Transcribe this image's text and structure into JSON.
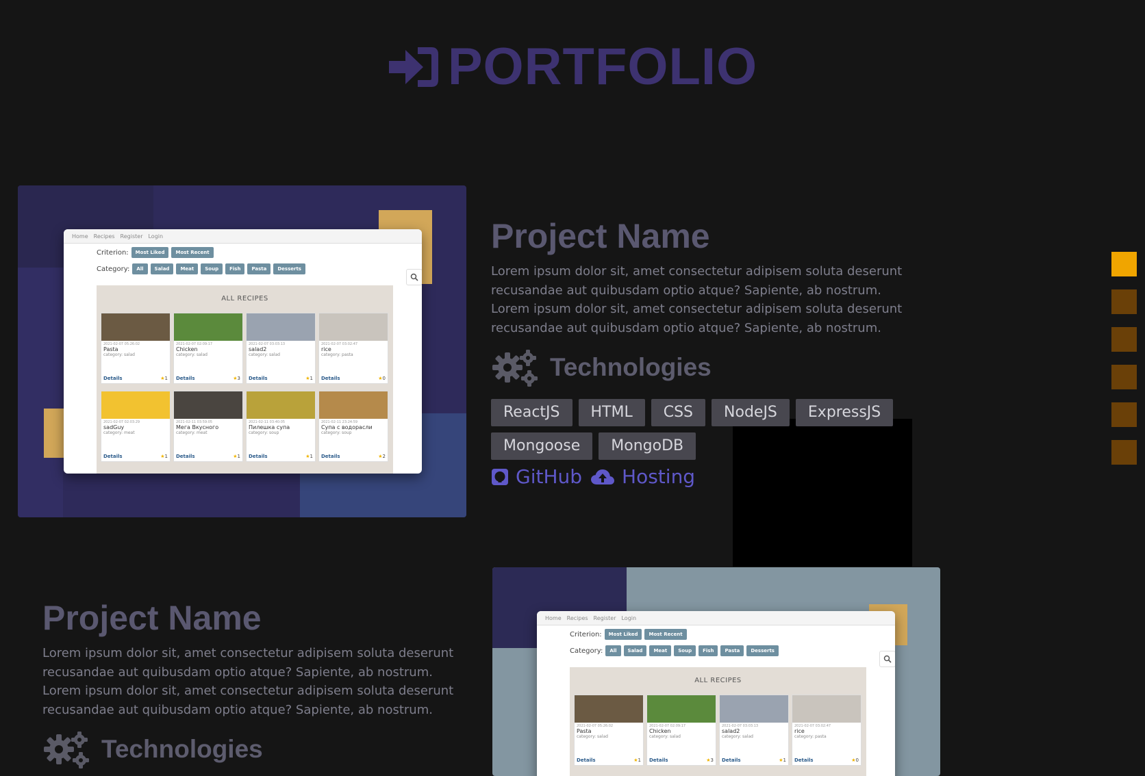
{
  "header": {
    "title": "PORTFOLIO",
    "icon": "sign-in-icon"
  },
  "projects": [
    {
      "name": "Project Name",
      "description": "Lorem ipsum dolor sit, amet consectetur adipisem soluta deserunt recusandae aut quibusdam optio atque? Sapiente, ab nostrum. Lorem ipsum dolor sit, amet consectetur adipisem soluta deserunt recusandae aut quibusdam optio atque? Sapiente, ab nostrum.",
      "tech_label": "Technologies",
      "technologies": [
        "ReactJS",
        "HTML",
        "CSS",
        "NodeJS",
        "ExpressJS",
        "Mongoose",
        "MongoDB"
      ],
      "links": {
        "github": "GitHub",
        "hosting": "Hosting"
      }
    },
    {
      "name": "Project Name",
      "description": "Lorem ipsum dolor sit, amet consectetur adipisem soluta deserunt recusandae aut quibusdam optio atque? Sapiente, ab nostrum. Lorem ipsum dolor sit, amet consectetur adipisem soluta deserunt recusandae aut quibusdam optio atque? Sapiente, ab nostrum.",
      "tech_label": "Technologies"
    }
  ],
  "preview": {
    "nav": [
      "Home",
      "Recipes",
      "Register",
      "Login"
    ],
    "criterion_label": "Criterion:",
    "criterion_options": [
      "Most Liked",
      "Most Recent"
    ],
    "category_label": "Category:",
    "categories": [
      "All",
      "Salad",
      "Meat",
      "Soup",
      "Fish",
      "Pasta",
      "Desserts"
    ],
    "section_title": "ALL RECIPES",
    "details_label": "Details",
    "recipes": [
      {
        "date": "2021-02-07 05:26:02",
        "name": "Pasta",
        "category": "category: salad",
        "likes": "1",
        "color": "#6b5a43"
      },
      {
        "date": "2021-02-07 02:09:17",
        "name": "Chicken",
        "category": "category: salad",
        "likes": "3",
        "color": "#5b8a3c"
      },
      {
        "date": "2021-02-07 03:03:13",
        "name": "salad2",
        "category": "category: salad",
        "likes": "1",
        "color": "#9aa3b0"
      },
      {
        "date": "2021-02-07 03:02:47",
        "name": "rice",
        "category": "category: pasta",
        "likes": "0",
        "color": "#c9c4bd"
      },
      {
        "date": "2021-02-07 02:03:29",
        "name": "sadGuy",
        "category": "category: meat",
        "likes": "1",
        "color": "#f2c230"
      },
      {
        "date": "2021-02-11 03:59:05",
        "name": "Мега Вкусного",
        "category": "category: meat",
        "likes": "1",
        "color": "#4a4540"
      },
      {
        "date": "2021-02-11 03:40:05",
        "name": "Пилешка супа",
        "category": "category: soup",
        "likes": "1",
        "color": "#b9a23a"
      },
      {
        "date": "2021-02-11 23:24:59",
        "name": "Супа с водорасли",
        "category": "category: soup",
        "likes": "2",
        "color": "#b58a4b"
      }
    ]
  },
  "colors": {
    "background": "#151515",
    "title": "#3d3270",
    "link": "#5f58c9",
    "nav_dot_active": "#f0a500",
    "nav_dot": "#6a4008"
  },
  "side_nav": {
    "count": 6,
    "active_index": 0
  }
}
